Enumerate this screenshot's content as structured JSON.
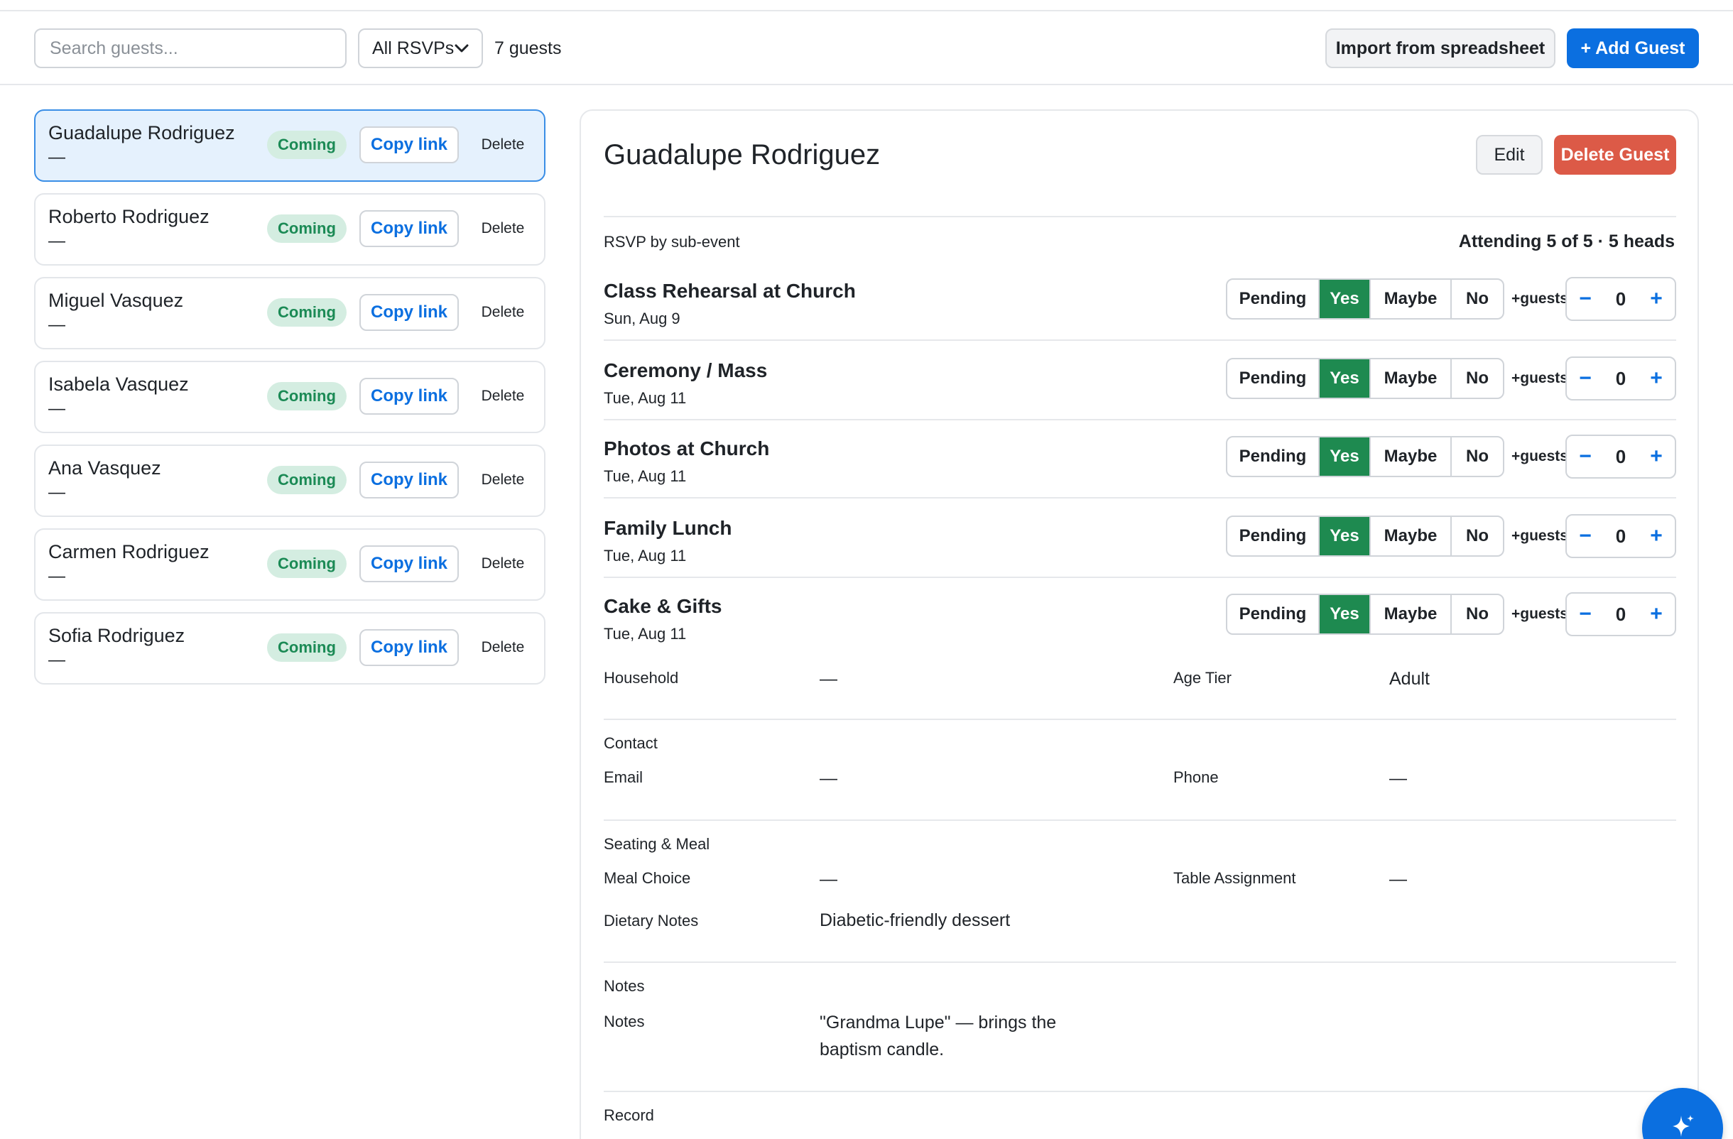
{
  "toolbar": {
    "search_placeholder": "Search guests...",
    "rsvp_filter": "All RSVPs",
    "guest_count": "7 guests",
    "import_label": "Import from spreadsheet",
    "add_label": "+ Add Guest"
  },
  "guests": [
    {
      "name": "Guadalupe Rodriguez",
      "household": "—",
      "status": "Coming",
      "copy": "Copy link",
      "delete": "Delete",
      "selected": true
    },
    {
      "name": "Roberto Rodriguez",
      "household": "—",
      "status": "Coming",
      "copy": "Copy link",
      "delete": "Delete"
    },
    {
      "name": "Miguel Vasquez",
      "household": "—",
      "status": "Coming",
      "copy": "Copy link",
      "delete": "Delete"
    },
    {
      "name": "Isabela Vasquez",
      "household": "—",
      "status": "Coming",
      "copy": "Copy link",
      "delete": "Delete"
    },
    {
      "name": "Ana Vasquez",
      "household": "—",
      "status": "Coming",
      "copy": "Copy link",
      "delete": "Delete"
    },
    {
      "name": "Carmen Rodriguez",
      "household": "—",
      "status": "Coming",
      "copy": "Copy link",
      "delete": "Delete"
    },
    {
      "name": "Sofia Rodriguez",
      "household": "—",
      "status": "Coming",
      "copy": "Copy link",
      "delete": "Delete"
    }
  ],
  "detail": {
    "name": "Guadalupe Rodriguez",
    "edit_label": "Edit",
    "delete_label": "Delete Guest",
    "rsvp_heading": "RSVP by sub-event",
    "attending": "Attending 5 of 5 · 5 heads",
    "rsvp_options": {
      "pending": "Pending",
      "yes": "Yes",
      "maybe": "Maybe",
      "no": "No"
    },
    "plus_guests_label": "+guests",
    "stepper": {
      "minus": "−",
      "plus": "+"
    },
    "events": [
      {
        "name": "Class Rehearsal at Church",
        "date": "Sun, Aug 9",
        "rsvp": "Yes",
        "plus_guests": "0"
      },
      {
        "name": "Ceremony / Mass",
        "date": "Tue, Aug 11",
        "rsvp": "Yes",
        "plus_guests": "0"
      },
      {
        "name": "Photos at Church",
        "date": "Tue, Aug 11",
        "rsvp": "Yes",
        "plus_guests": "0"
      },
      {
        "name": "Family Lunch",
        "date": "Tue, Aug 11",
        "rsvp": "Yes",
        "plus_guests": "0"
      },
      {
        "name": "Cake & Gifts",
        "date": "Tue, Aug 11",
        "rsvp": "Yes",
        "plus_guests": "0"
      }
    ],
    "household": {
      "label": "Household",
      "value": "—"
    },
    "age_tier": {
      "label": "Age Tier",
      "value": "Adult"
    },
    "contact": {
      "title": "Contact",
      "email_label": "Email",
      "email_value": "—",
      "phone_label": "Phone",
      "phone_value": "—"
    },
    "seating": {
      "title": "Seating & Meal",
      "meal_label": "Meal Choice",
      "meal_value": "—",
      "table_label": "Table Assignment",
      "table_value": "—",
      "dietary_label": "Dietary Notes",
      "dietary_value": "Diabetic-friendly dessert"
    },
    "notes": {
      "title": "Notes",
      "label": "Notes",
      "line1": "\"Grandma Lupe\" — brings the",
      "line2": "baptism candle."
    },
    "record": {
      "title": "Record"
    }
  },
  "icons": {
    "fab": "sparkle-icon",
    "dropdown": "chevron-down-icon"
  },
  "colors": {
    "primary": "#0b6fe0",
    "danger": "#dc5a47",
    "yes": "#1e8a50",
    "coming_bg": "#d4ede1",
    "coming_text": "#1b8a55",
    "selected_bg": "#e5f1fd"
  }
}
